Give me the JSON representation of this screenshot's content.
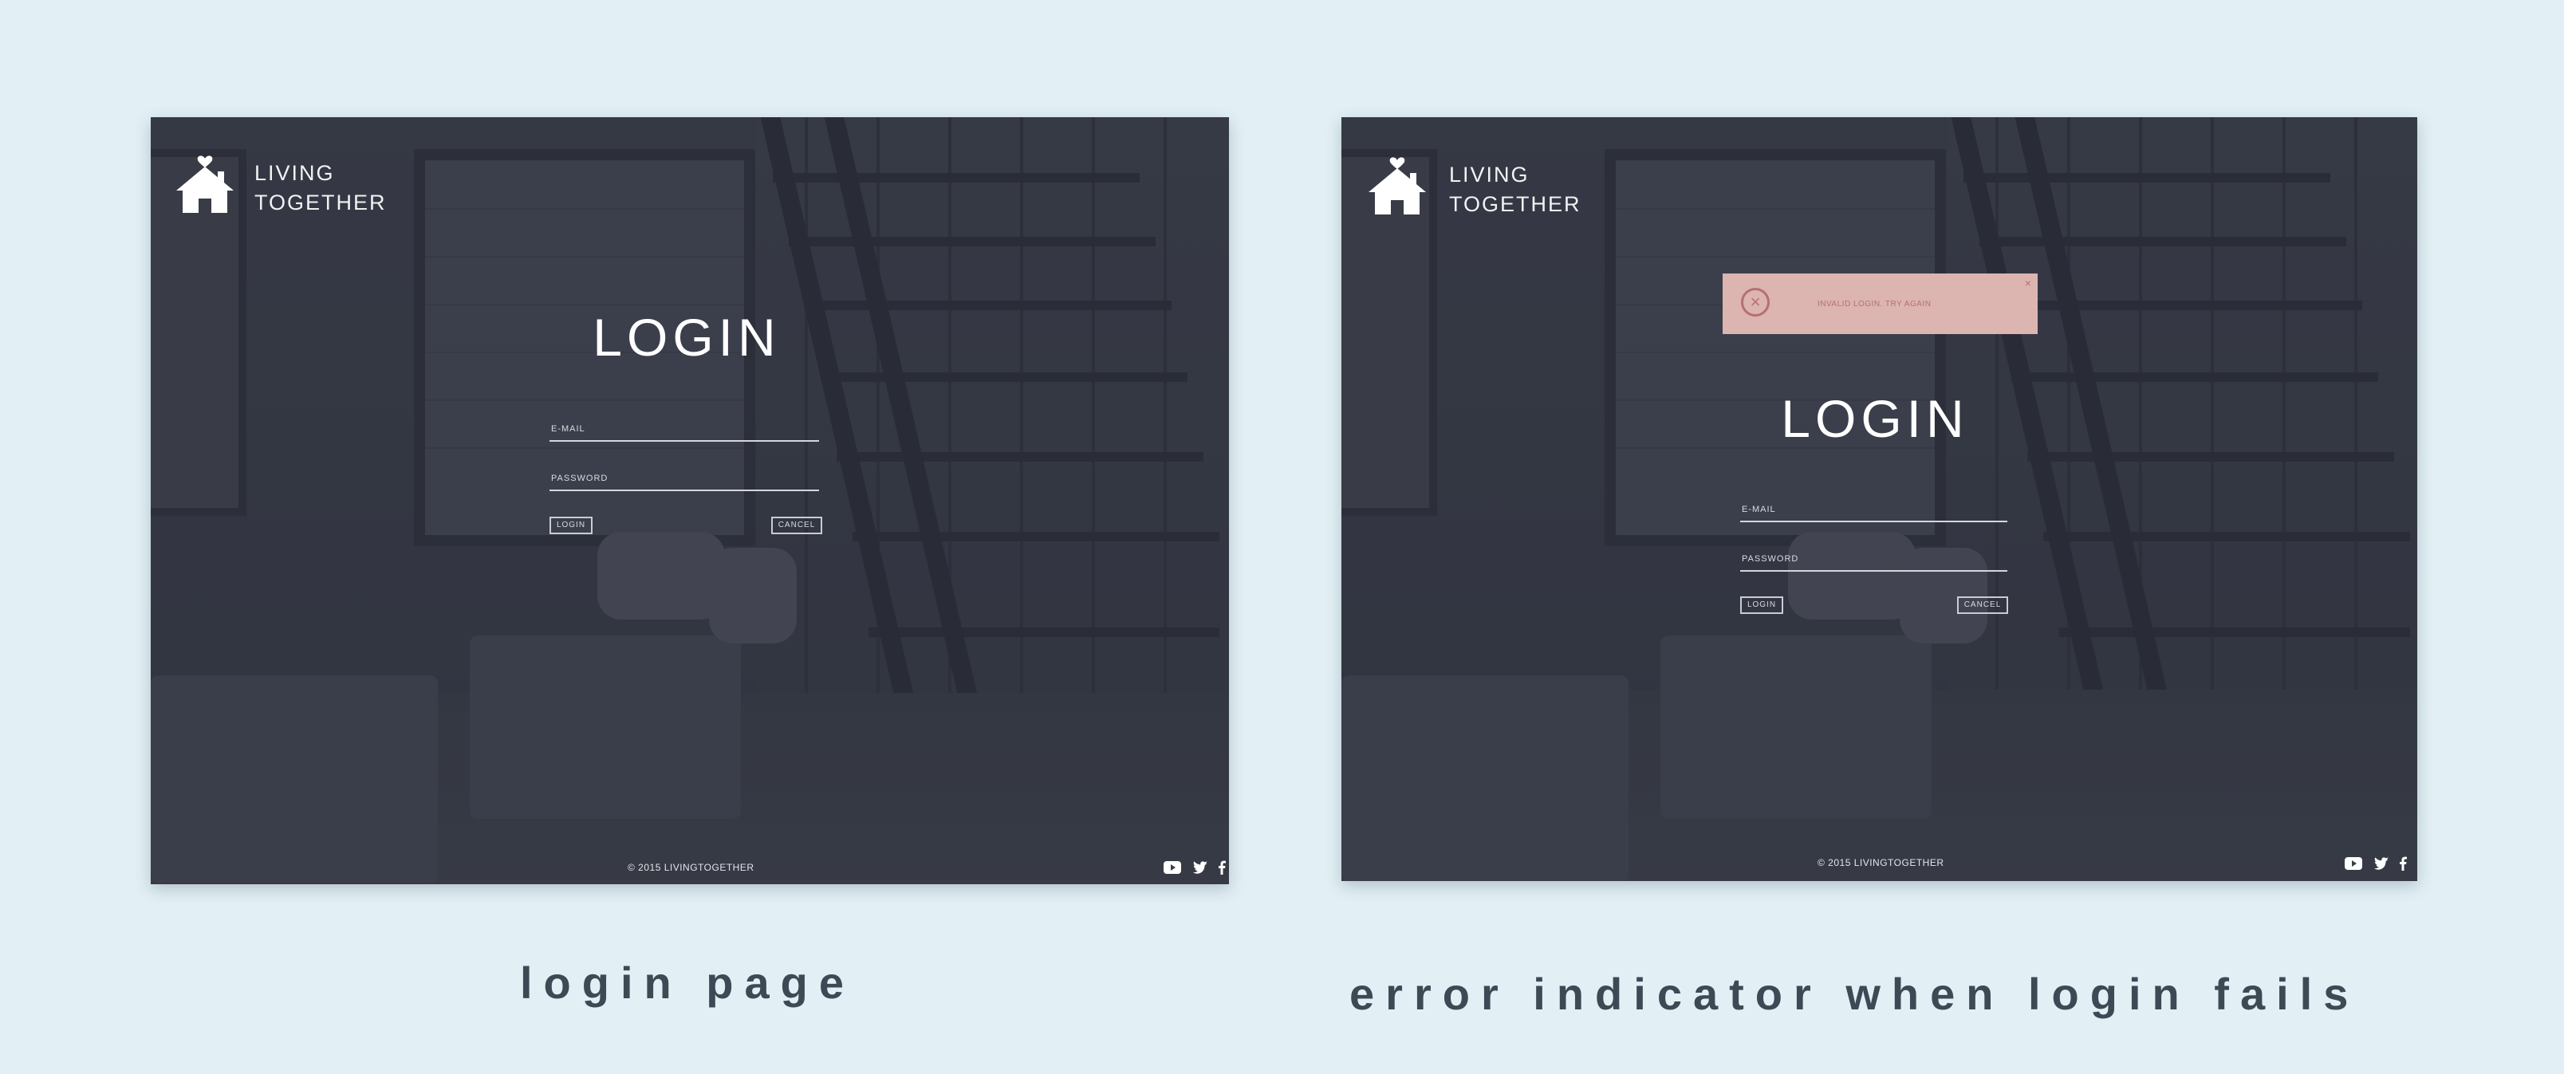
{
  "brand": {
    "line1": "LIVING",
    "line2": "TOGETHER"
  },
  "login_page": {
    "title": "LOGIN",
    "email_label": "E-MAIL",
    "password_label": "PASSWORD",
    "login_button": "LOGIN",
    "cancel_button": "CANCEL",
    "footer": "© 2015 LIVINGTOGETHER"
  },
  "error_page": {
    "title": "LOGIN",
    "email_label": "E-MAIL",
    "password_label": "PASSWORD",
    "login_button": "LOGIN",
    "cancel_button": "CANCEL",
    "footer": "© 2015 LIVINGTOGETHER",
    "error_message": "INVALID LOGIN. TRY AGAIN",
    "error_close": "×",
    "error_icon_glyph": "×"
  },
  "social_icons": [
    "youtube-icon",
    "twitter-icon",
    "facebook-icon"
  ],
  "captions": {
    "left": "login page",
    "right": "error indicator when login fails"
  },
  "colors": {
    "page_background": "#e2f0f5",
    "panel": "#3a3e48",
    "error_background": "#dcb4b0",
    "error_text": "#b66f75",
    "caption": "#3d4a56"
  }
}
